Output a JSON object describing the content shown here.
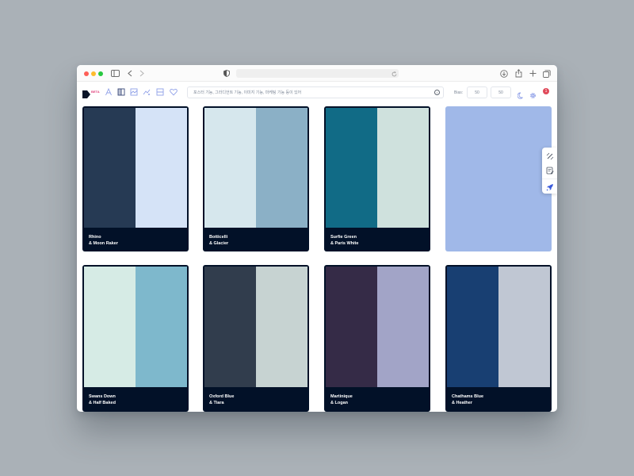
{
  "browser": {
    "window_controls": [
      "close",
      "minimize",
      "zoom"
    ],
    "icons": [
      "sidebar-icon",
      "back-icon",
      "forward-icon",
      "shield-icon",
      "reload-icon",
      "download-icon",
      "share-icon",
      "new-tab-icon",
      "tabs-overview-icon"
    ]
  },
  "app": {
    "beta_badge": "BETA",
    "toolbar_icons": [
      "font-icon",
      "columns-icon",
      "image-icon",
      "gradient-icon",
      "layout-icon",
      "heart-icon"
    ],
    "search": {
      "placeholder": "포스터 기능, 그라디언트 기능, 이미지 기능, 마케팅 기능 등이 있어"
    },
    "bias": {
      "label": "Bias:",
      "value_a": "50",
      "value_b": "50"
    },
    "right_icons": [
      "moon-icon",
      "gear-icon"
    ],
    "notification_count": "1"
  },
  "side_panel": {
    "icons": [
      "brush-icon",
      "edit-note-icon",
      "rocket-icon"
    ]
  },
  "palettes": [
    {
      "line1": "Rhino",
      "line2": "& Moon Raker",
      "color_left": "#263a54",
      "color_right": "#d5e3f7"
    },
    {
      "line1": "Botticelli",
      "line2": "& Glacier",
      "color_left": "#d6e7ed",
      "color_right": "#8bb0c6"
    },
    {
      "line1": "Surfie Green",
      "line2": "& Paris White",
      "color_left": "#116b86",
      "color_right": "#cfe1dd"
    },
    {
      "line1": "",
      "line2": "",
      "color_left": "#a0b8e8",
      "color_right": "#a0b8e8"
    },
    {
      "line1": "Swans Down",
      "line2": "& Half Baked",
      "color_left": "#d6ebe5",
      "color_right": "#7eb8cc"
    },
    {
      "line1": "Oxford Blue",
      "line2": "& Tiara",
      "color_left": "#313d4d",
      "color_right": "#c7d3d2"
    },
    {
      "line1": "Martinique",
      "line2": "& Logan",
      "color_left": "#352b47",
      "color_right": "#a2a4c7"
    },
    {
      "line1": "Chathams Blue",
      "line2": "& Heather",
      "color_left": "#183f72",
      "color_right": "#c0c7d3"
    }
  ]
}
